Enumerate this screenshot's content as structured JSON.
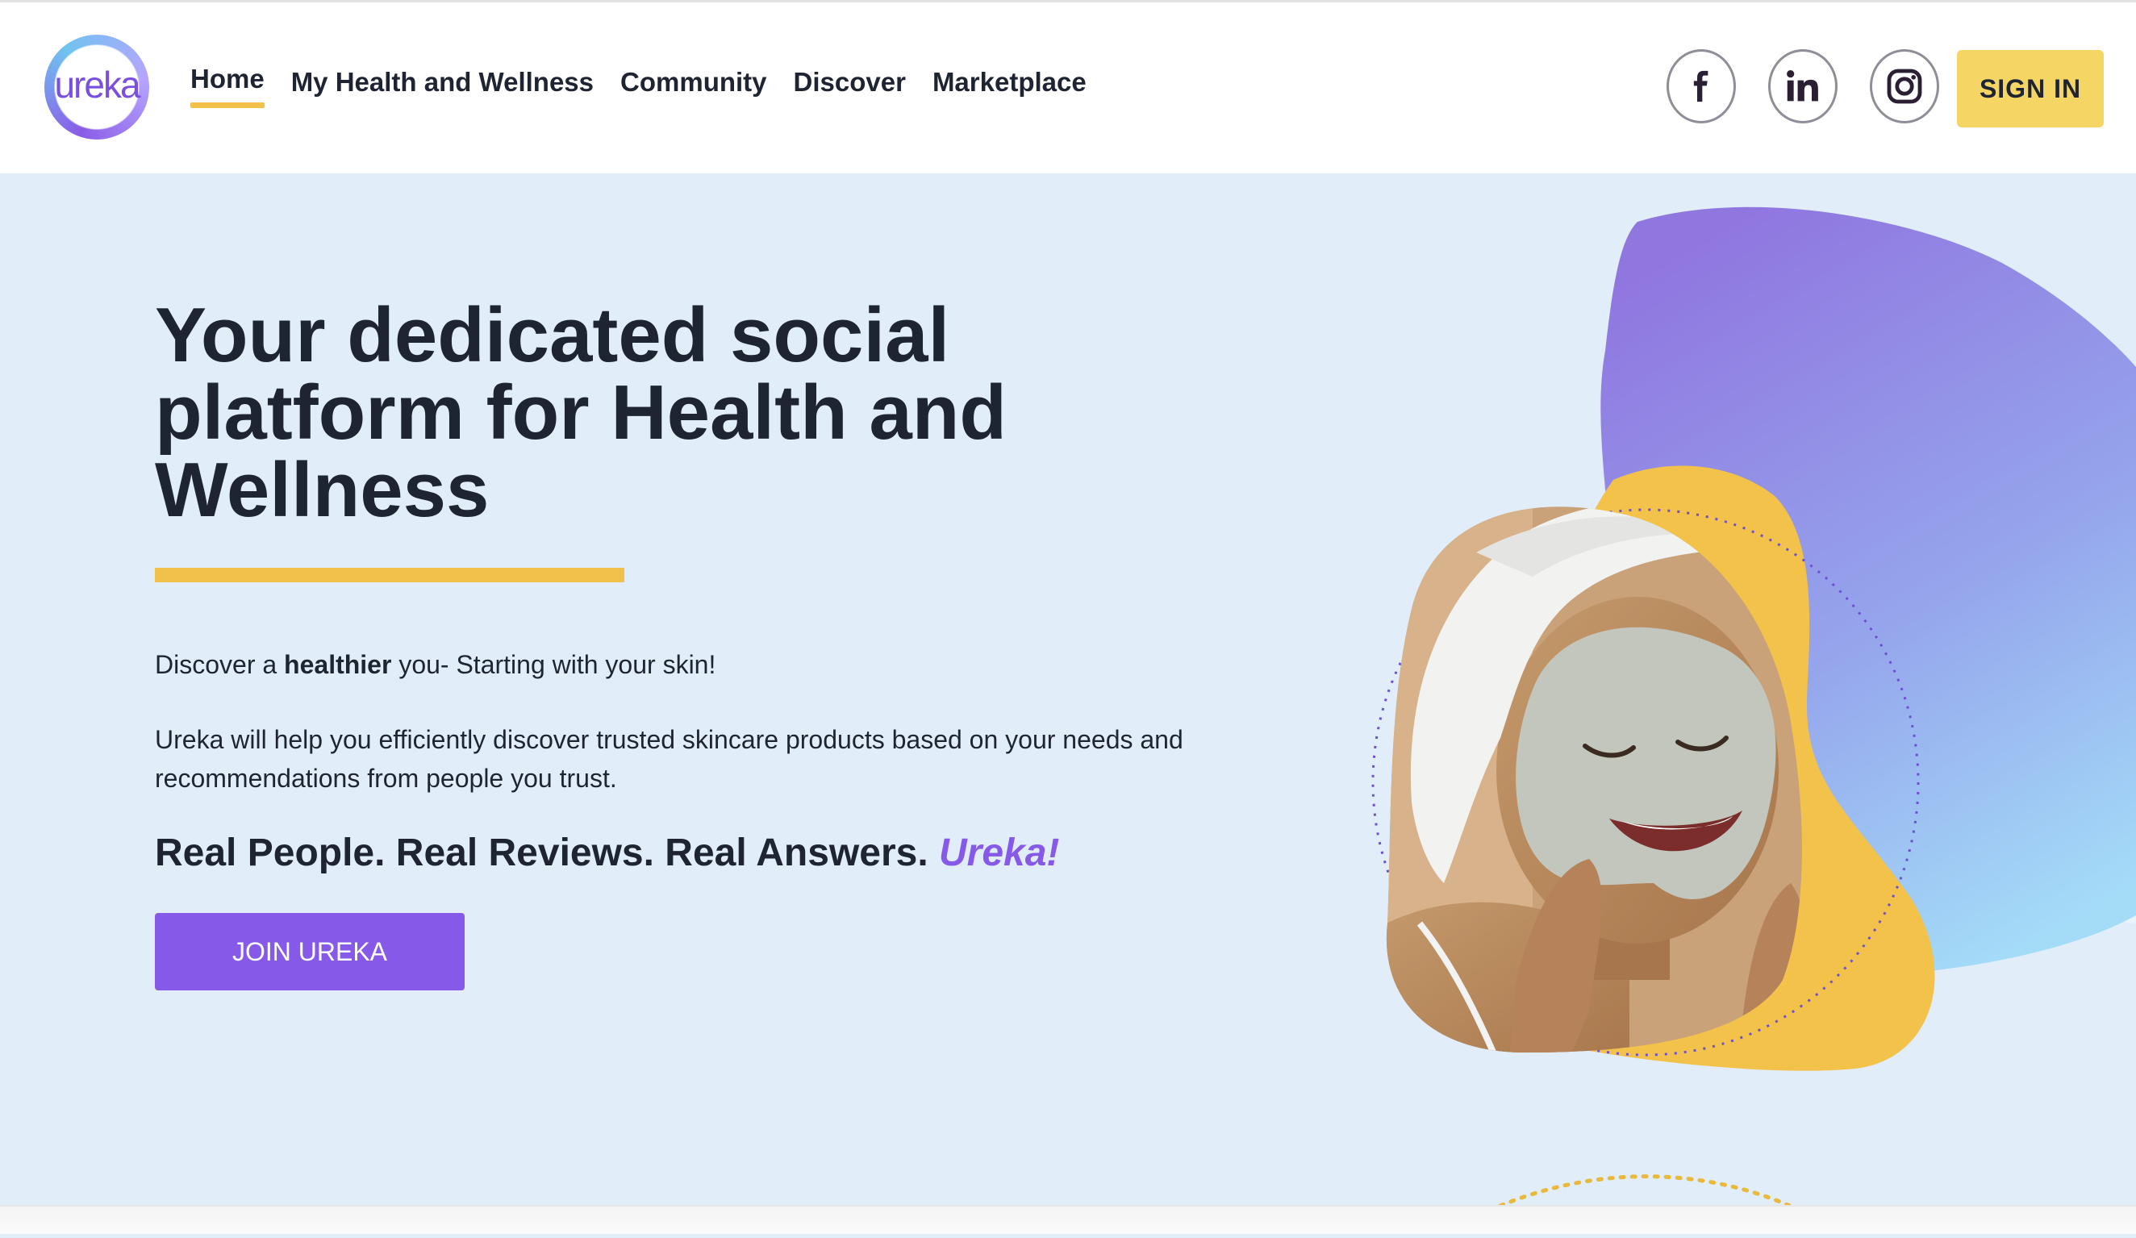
{
  "brand": {
    "logo_text": "ureka"
  },
  "nav": {
    "items": [
      {
        "label": "Home",
        "active": true
      },
      {
        "label": "My Health and Wellness"
      },
      {
        "label": "Community"
      },
      {
        "label": "Discover"
      },
      {
        "label": "Marketplace"
      }
    ]
  },
  "social": {
    "icons": [
      "facebook-icon",
      "linkedin-icon",
      "instagram-icon"
    ]
  },
  "header": {
    "signin_label": "SIGN IN"
  },
  "hero": {
    "title": "Your dedicated social platform for Health and Wellness",
    "tagline_pre": "Discover a ",
    "tagline_bold": "healthier",
    "tagline_post": " you- Starting with your skin!",
    "description": "Ureka will help you efficiently discover trusted skincare products based on your needs and recommendations from people you trust.",
    "slogan": "Real People. Real Reviews. Real Answers. ",
    "slogan_brand": "Ureka!",
    "cta_label": "JOIN UREKA"
  },
  "colors": {
    "accent_purple": "#8659e9",
    "accent_yellow": "#f2c14c",
    "hero_bg": "#e1eefa",
    "text_dark": "#1f2433"
  }
}
